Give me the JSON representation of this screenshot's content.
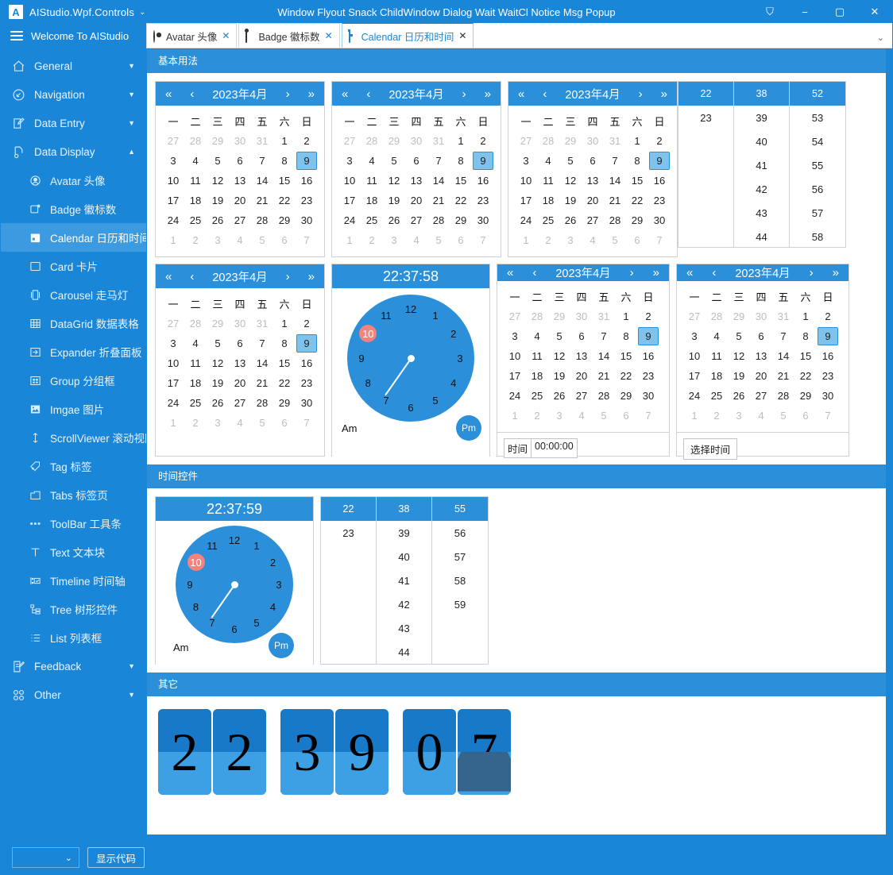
{
  "window": {
    "app_title": "AIStudio.Wpf.Controls",
    "app_logo_letter": "A",
    "title_dropdown_caret": "⌄",
    "center_menu": "Window Flyout Snack ChildWindow Dialog Wait WaitCl Notice Msg Popup",
    "pin_icon": "⛉",
    "minimize": "−",
    "maximize": "▢",
    "close": "✕",
    "brand": "Welcome To AIStudio",
    "tabstrip_overflow_caret": "⌄"
  },
  "tabs": [
    {
      "label": "Avatar 头像",
      "icon": "avatar-icon",
      "close": "✕",
      "active": false
    },
    {
      "label": "Badge 徽标数",
      "icon": "badge-icon",
      "close": "✕",
      "active": false
    },
    {
      "label": "Calendar 日历和时间",
      "icon": "calendar-icon",
      "close": "✕",
      "active": true
    }
  ],
  "sidebar": {
    "groups": [
      {
        "label": "General",
        "icon": "home-icon",
        "arrow": "▼",
        "expanded": false
      },
      {
        "label": "Navigation",
        "icon": "navigation-icon",
        "arrow": "▼",
        "expanded": false
      },
      {
        "label": "Data Entry",
        "icon": "data-entry-icon",
        "arrow": "▼",
        "expanded": false
      },
      {
        "label": "Data Display",
        "icon": "data-display-icon",
        "arrow": "▲",
        "expanded": true
      }
    ],
    "items": [
      {
        "label": "Avatar 头像",
        "icon": "avatar-icon",
        "selected": false
      },
      {
        "label": "Badge 徽标数",
        "icon": "badge-icon",
        "selected": false
      },
      {
        "label": "Calendar 日历和时间",
        "icon": "calendar-icon",
        "selected": true
      },
      {
        "label": "Card 卡片",
        "icon": "card-icon",
        "selected": false
      },
      {
        "label": "Carousel 走马灯",
        "icon": "carousel-icon",
        "selected": false
      },
      {
        "label": "DataGrid 数据表格",
        "icon": "datagrid-icon",
        "selected": false
      },
      {
        "label": "Expander 折叠面板",
        "icon": "expander-icon",
        "selected": false
      },
      {
        "label": "Group 分组框",
        "icon": "group-icon",
        "selected": false
      },
      {
        "label": "Imgae 图片",
        "icon": "image-icon",
        "selected": false
      },
      {
        "label": "ScrollViewer 滚动视图",
        "icon": "scrollviewer-icon",
        "selected": false
      },
      {
        "label": "Tag 标签",
        "icon": "tag-icon",
        "selected": false
      },
      {
        "label": "Tabs 标签页",
        "icon": "tabs-icon",
        "selected": false
      },
      {
        "label": "ToolBar 工具条",
        "icon": "toolbar-icon",
        "selected": false
      },
      {
        "label": "Text 文本块",
        "icon": "text-icon",
        "selected": false
      },
      {
        "label": "Timeline 时间轴",
        "icon": "timeline-icon",
        "selected": false
      },
      {
        "label": "Tree 树形控件",
        "icon": "tree-icon",
        "selected": false
      },
      {
        "label": "List 列表框",
        "icon": "list-icon",
        "selected": false
      }
    ],
    "groups_bottom": [
      {
        "label": "Feedback",
        "icon": "feedback-icon",
        "arrow": "▼"
      },
      {
        "label": "Other",
        "icon": "other-icon",
        "arrow": "▼"
      }
    ]
  },
  "sections": {
    "basic": "基本用法",
    "time_controls": "时间控件",
    "other": "其它"
  },
  "calendar": {
    "month_title": "2023年4月",
    "nav": {
      "prev_year": "«",
      "prev_month": "‹",
      "next_month": "›",
      "next_year": "»"
    },
    "dow": [
      "一",
      "二",
      "三",
      "四",
      "五",
      "六",
      "日"
    ],
    "weeks": [
      [
        {
          "d": "27",
          "out": true
        },
        {
          "d": "28",
          "out": true
        },
        {
          "d": "29",
          "out": true
        },
        {
          "d": "30",
          "out": true
        },
        {
          "d": "31",
          "out": true
        },
        {
          "d": "1"
        },
        {
          "d": "2"
        }
      ],
      [
        {
          "d": "3"
        },
        {
          "d": "4"
        },
        {
          "d": "5"
        },
        {
          "d": "6"
        },
        {
          "d": "7"
        },
        {
          "d": "8"
        },
        {
          "d": "9",
          "sel": true
        }
      ],
      [
        {
          "d": "10"
        },
        {
          "d": "11"
        },
        {
          "d": "12"
        },
        {
          "d": "13"
        },
        {
          "d": "14"
        },
        {
          "d": "15"
        },
        {
          "d": "16"
        }
      ],
      [
        {
          "d": "17"
        },
        {
          "d": "18"
        },
        {
          "d": "19"
        },
        {
          "d": "20"
        },
        {
          "d": "21"
        },
        {
          "d": "22"
        },
        {
          "d": "23"
        }
      ],
      [
        {
          "d": "24"
        },
        {
          "d": "25"
        },
        {
          "d": "26"
        },
        {
          "d": "27"
        },
        {
          "d": "28"
        },
        {
          "d": "29"
        },
        {
          "d": "30"
        }
      ],
      [
        {
          "d": "1",
          "out": true
        },
        {
          "d": "2",
          "out": true
        },
        {
          "d": "3",
          "out": true
        },
        {
          "d": "4",
          "out": true
        },
        {
          "d": "5",
          "out": true
        },
        {
          "d": "6",
          "out": true
        },
        {
          "d": "7",
          "out": true
        }
      ]
    ],
    "selected_day": "9",
    "time_field_label": "时间",
    "time_field_value": "00:00:00",
    "select_time_button": "选择时间"
  },
  "list_columns_top": [
    {
      "header": "22",
      "items": [
        "23"
      ]
    },
    {
      "header": "38",
      "items": [
        "39",
        "40",
        "41",
        "42",
        "43",
        "44"
      ]
    },
    {
      "header": "52",
      "items": [
        "53",
        "54",
        "55",
        "56",
        "57",
        "58"
      ]
    }
  ],
  "list_columns_bottom": [
    {
      "header": "22",
      "items": [
        "23"
      ]
    },
    {
      "header": "38",
      "items": [
        "39",
        "40",
        "41",
        "42",
        "43",
        "44"
      ]
    },
    {
      "header": "55",
      "items": [
        "56",
        "57",
        "58",
        "59"
      ]
    }
  ],
  "clock_top": {
    "time_display": "22:37:58",
    "hours": [
      "12",
      "1",
      "2",
      "3",
      "4",
      "5",
      "6",
      "7",
      "8",
      "9",
      "10",
      "11"
    ],
    "active_hour": "10",
    "hand_angle_deg": 215,
    "am_label": "Am",
    "pm_label": "Pm"
  },
  "clock_bottom": {
    "time_display": "22:37:59",
    "hours": [
      "12",
      "1",
      "2",
      "3",
      "4",
      "5",
      "6",
      "7",
      "8",
      "9",
      "10",
      "11"
    ],
    "active_hour": "10",
    "hand_angle_deg": 215,
    "am_label": "Am",
    "pm_label": "Pm"
  },
  "flip_clock": {
    "digits": [
      "2",
      "2",
      "3",
      "9",
      "0",
      "7"
    ],
    "flipping_index": 5
  },
  "bottom_bar": {
    "combo_value": "",
    "combo_caret": "⌄",
    "show_code_button": "显示代码"
  },
  "colors": {
    "brand_blue": "#1a86d8",
    "header_blue": "#2b90d9",
    "selected_nav": "#3c9ae0",
    "selected_day_bg": "#7fc3ec",
    "active_hour_red": "#f4827d",
    "flip_top": "#1879c8",
    "flip_bottom": "#3d9fe4",
    "flip_fold": "#35658c"
  }
}
